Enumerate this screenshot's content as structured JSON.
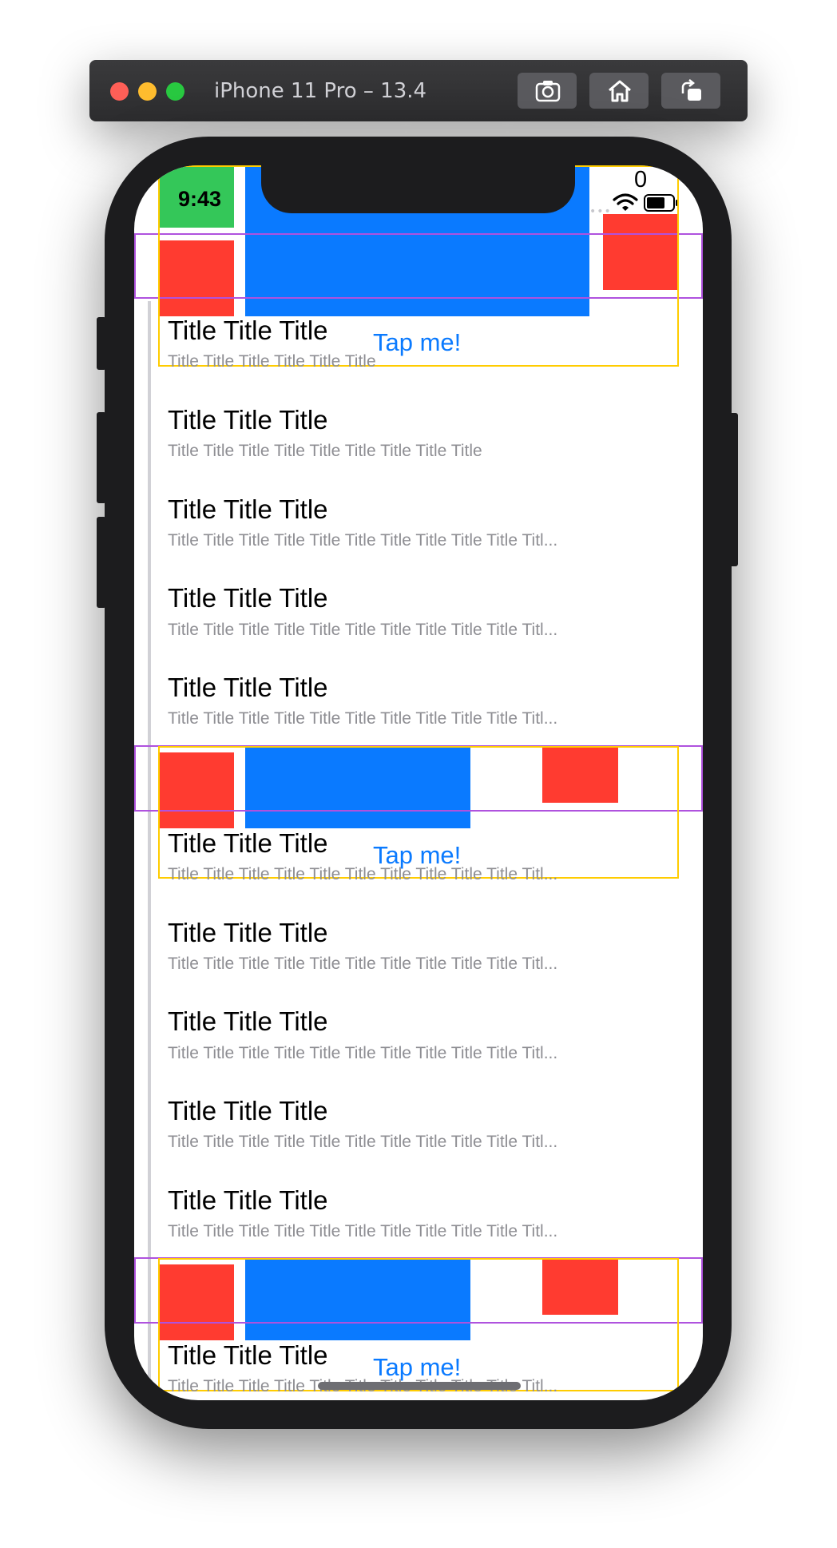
{
  "window": {
    "title": "iPhone 11 Pro – 13.4",
    "toolbar": [
      "screenshot-icon",
      "home-icon",
      "rotate-icon"
    ],
    "colors": {
      "close": "#ff5f57",
      "minimize": "#febc2e",
      "zoom": "#28c840"
    }
  },
  "status_bar": {
    "time": "9:43",
    "counter": "0",
    "icons": [
      "wifi-icon",
      "battery-icon"
    ]
  },
  "tap_label": "Tap me!",
  "rows": [
    {
      "title": "Title Title Title",
      "subtitle": "Title Title Title  Title Title Title"
    },
    {
      "title": "Title Title Title",
      "subtitle": "Title Title Title  Title Title Title  Title Title Title"
    },
    {
      "title": "Title Title Title",
      "subtitle": "Title Title Title  Title Title Title  Title Title Title  Title Titl..."
    },
    {
      "title": "Title Title Title",
      "subtitle": "Title Title Title  Title Title Title  Title Title Title  Title Titl..."
    },
    {
      "title": "Title Title Title",
      "subtitle": "Title Title Title  Title Title Title  Title Title Title  Title Titl..."
    },
    {
      "title": "Title Title Title",
      "subtitle": "Title Title Title  Title Title Title  Title Title Title  Title Titl..."
    },
    {
      "title": "Title Title Title",
      "subtitle": "Title Title Title  Title Title Title  Title Title Title  Title Titl..."
    },
    {
      "title": "Title Title Title",
      "subtitle": "Title Title Title  Title Title Title  Title Title Title  Title Titl..."
    },
    {
      "title": "Title Title Title",
      "subtitle": "Title Title Title  Title Title Title  Title Title Title  Title Titl..."
    },
    {
      "title": "Title Title Title",
      "subtitle": "Title Title Title  Title Title Title  Title Title Title  Title Titl..."
    },
    {
      "title": "Title Title Title",
      "subtitle": "Title Title Title  Title Title Title  Title Title Title  Title Titl..."
    }
  ],
  "colors": {
    "accent": "#0a7aff",
    "red": "#ff3b30",
    "green": "#34c759",
    "debug_purple": "#af52de",
    "debug_yellow": "#ffcc00"
  }
}
